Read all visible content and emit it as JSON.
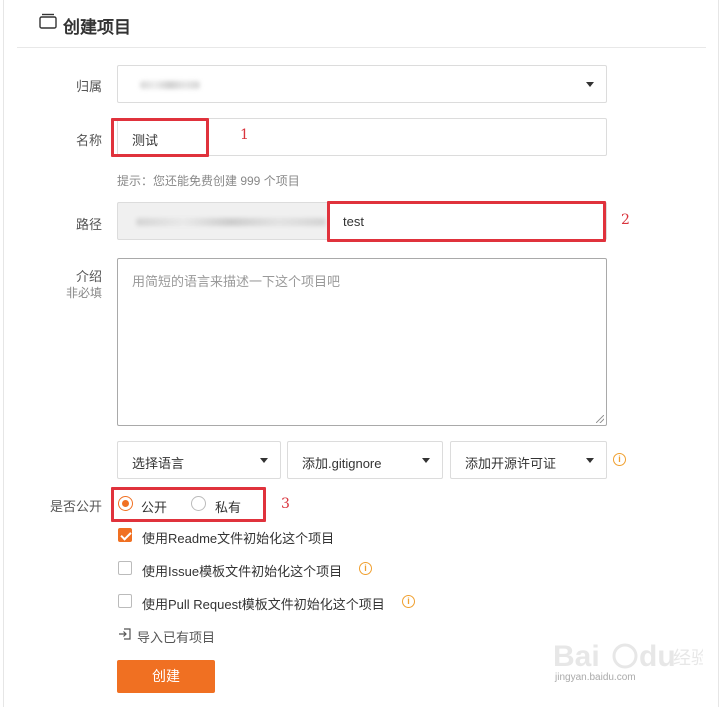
{
  "header": {
    "title": "创建项目",
    "icon": "folder-icon"
  },
  "form": {
    "owner": {
      "label": "归属"
    },
    "name": {
      "label": "名称",
      "value": "测试",
      "hint": "提示：您还能免费创建 999 个项目"
    },
    "path": {
      "label": "路径",
      "value": "test"
    },
    "description": {
      "label": "介绍",
      "sublabel": "非必填",
      "placeholder": "用简短的语言来描述一下这个项目吧"
    },
    "selects": {
      "language": "选择语言",
      "gitignore": "添加.gitignore",
      "license": "添加开源许可证"
    },
    "visibility": {
      "label": "是否公开",
      "public": "公开",
      "private": "私有",
      "selected": "public"
    },
    "checkboxes": [
      {
        "label": "使用Readme文件初始化这个项目",
        "checked": true
      },
      {
        "label": "使用Issue模板文件初始化这个项目",
        "checked": false
      },
      {
        "label": "使用Pull Request模板文件初始化这个项目",
        "checked": false
      }
    ],
    "import_link": "导入已有项目",
    "submit": "创建"
  },
  "annotations": {
    "n1": "1",
    "n2": "2",
    "n3": "3"
  },
  "watermark": {
    "url": "jingyan.baidu.com"
  },
  "colors": {
    "accent": "#f07022",
    "annotation": "#e0323c",
    "info": "#f0a030"
  }
}
